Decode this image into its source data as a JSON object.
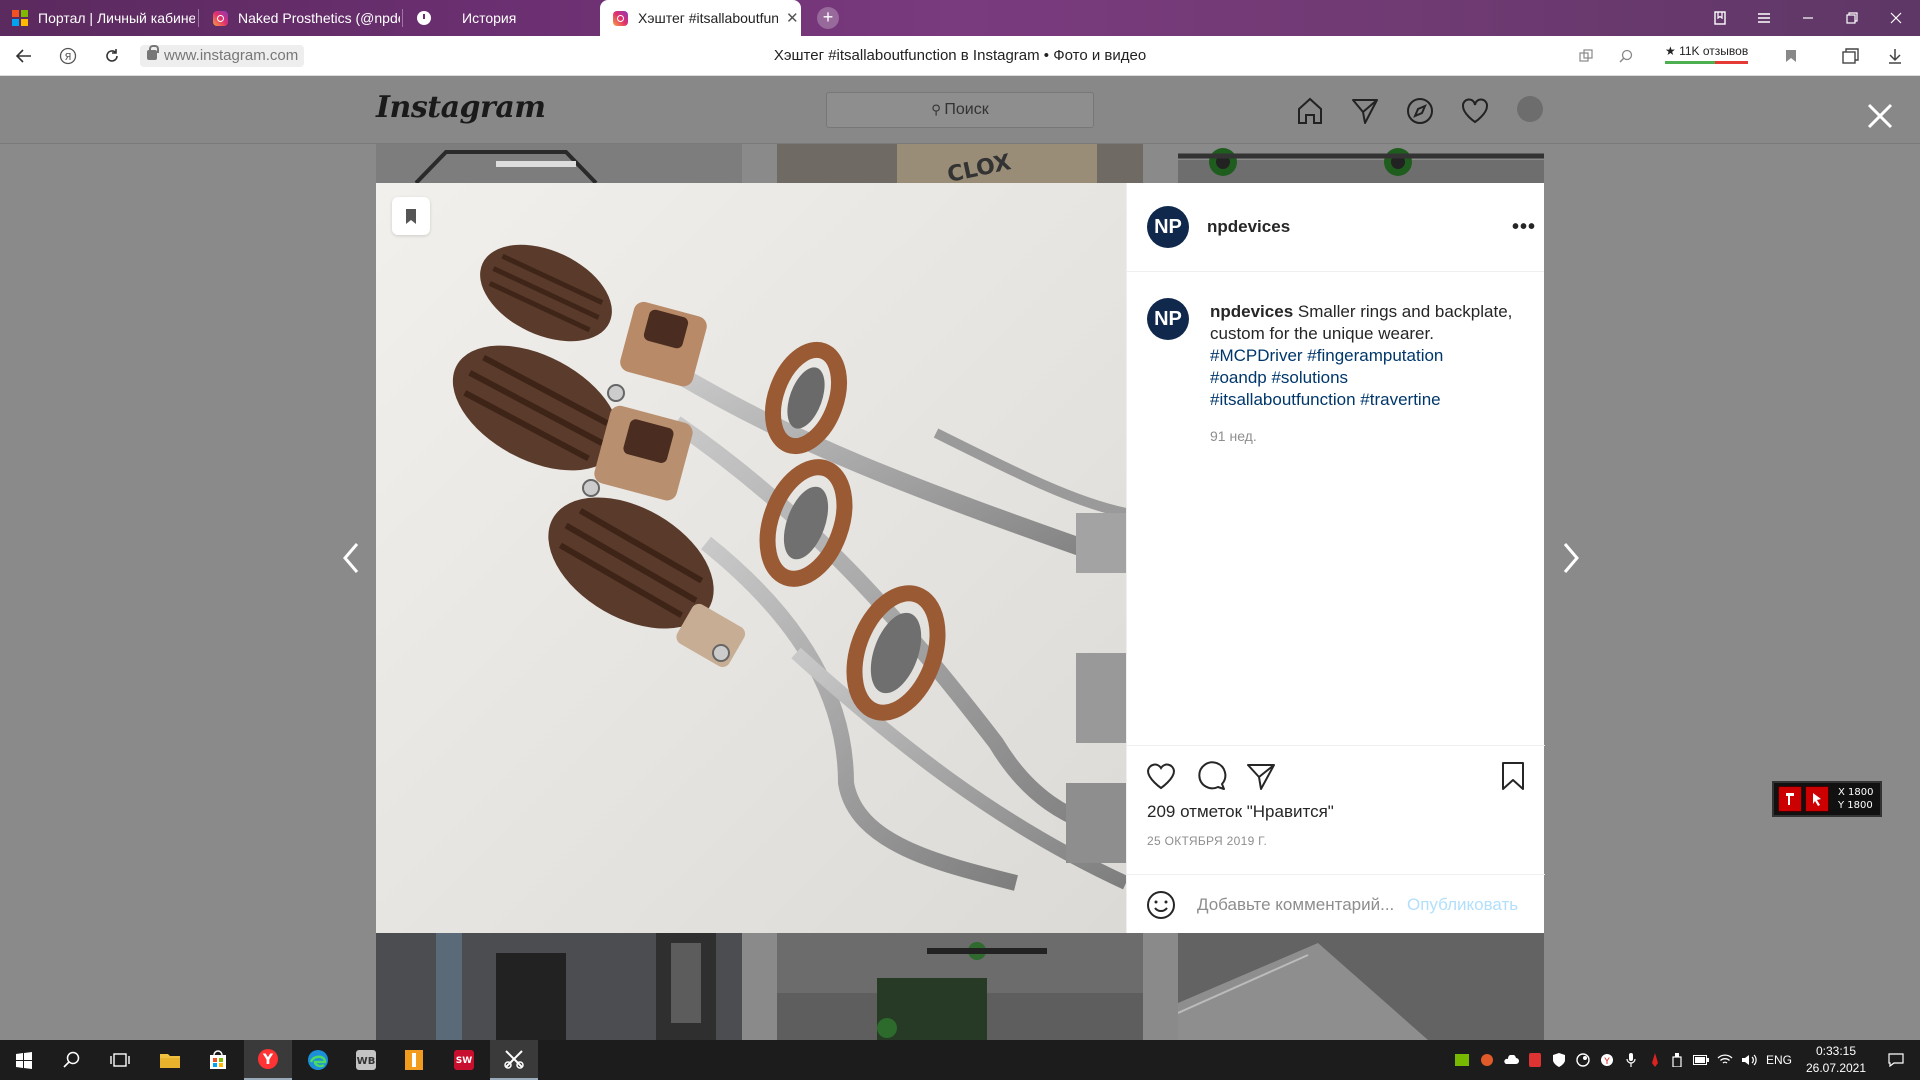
{
  "browser": {
    "tabs": [
      {
        "title": "Портал | Личный кабинет",
        "icon": "windows-logo-icon"
      },
      {
        "title": "Naked Prosthetics (@npde",
        "icon": "instagram-icon"
      },
      {
        "title": "История",
        "icon": "history-icon"
      },
      {
        "title": "Хэштег #itsallaboutfunc",
        "icon": "instagram-icon",
        "active": true
      }
    ],
    "url": "www.instagram.com",
    "page_title": "Хэштег #itsallaboutfunction в Instagram • Фото и видео",
    "reviews_badge": "★ 11K отзывов"
  },
  "instagram": {
    "logo": "Instagram",
    "search_placeholder": "Поиск"
  },
  "post": {
    "username": "npdevices",
    "avatar_initials": "NP",
    "caption_user": "npdevices",
    "caption_text": "Smaller rings and backplate, custom for the unique wearer.",
    "hashtags": [
      "#MCPDriver",
      "#fingeramputation",
      "#oandp",
      "#solutions",
      "#itsallaboutfunction",
      "#travertine"
    ],
    "age": "91 нед.",
    "likes": "209 отметок \"Нравится\"",
    "date": "25 ОКТЯБРЯ 2019 Г.",
    "comment_placeholder": "Добавьте комментарий...",
    "publish_label": "Опубликовать"
  },
  "overlay": {
    "x_label": "X 1800",
    "y_label": "Y 1800"
  },
  "taskbar": {
    "lang": "ENG",
    "time": "0:33:15",
    "date": "26.07.2021"
  },
  "colors": {
    "tab_bar": "#6a2f70",
    "link": "#00376b",
    "avatar": "#10284c",
    "publish": "#b2dffc"
  }
}
